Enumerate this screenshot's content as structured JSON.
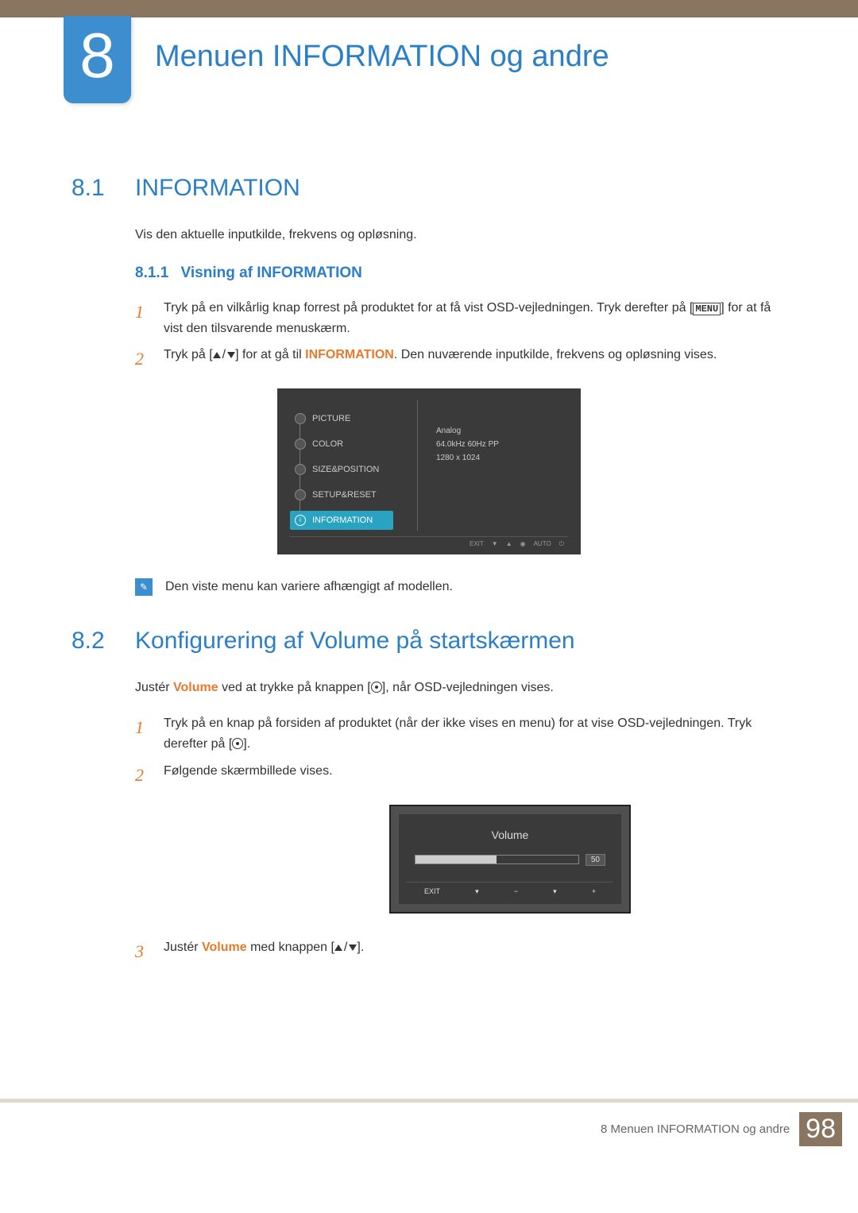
{
  "chapter": {
    "number": "8",
    "title": "Menuen INFORMATION og andre"
  },
  "s81": {
    "num": "8.1",
    "title": "INFORMATION",
    "intro": "Vis den aktuelle inputkilde, frekvens og opløsning.",
    "sub": {
      "num": "8.1.1",
      "title": "Visning af INFORMATION"
    },
    "step1a": "Tryk på en vilkårlig knap forrest på produktet for at få vist OSD-vejledningen. Tryk derefter på [",
    "step1_key": "MENU",
    "step1b": "] for at få vist den tilsvarende menuskærm.",
    "step2a": "Tryk på [",
    "step2b": "] for at gå til ",
    "step2_hl": "INFORMATION",
    "step2c": ". Den nuværende inputkilde, frekvens og opløsning vises.",
    "note": "Den viste menu kan variere afhængigt af modellen.",
    "osd": {
      "items": [
        "PICTURE",
        "COLOR",
        "SIZE&POSITION",
        "SETUP&RESET",
        "INFORMATION"
      ],
      "info1": "Analog",
      "info2": "64.0kHz 60Hz PP",
      "info3": "1280 x 1024",
      "exit": "EXIT",
      "auto": "AUTO"
    }
  },
  "s82": {
    "num": "8.2",
    "title": "Konfigurering af Volume på startskærmen",
    "intro1": "Justér ",
    "intro_hl": "Volume",
    "intro2": " ved at trykke på knappen [",
    "intro3": "], når OSD-vejledningen vises.",
    "step1a": "Tryk på en knap på forsiden af produktet (når der ikke vises en menu) for at vise OSD-vejledningen. Tryk derefter på [",
    "step1b": "].",
    "step2": "Følgende skærmbillede vises.",
    "step3a": "Justér ",
    "step3_hl": "Volume",
    "step3b": " med knappen [",
    "step3c": "].",
    "osd": {
      "title": "Volume",
      "value": "50",
      "exit": "EXIT"
    }
  },
  "footer": {
    "text": "8 Menuen INFORMATION og andre",
    "page": "98"
  }
}
